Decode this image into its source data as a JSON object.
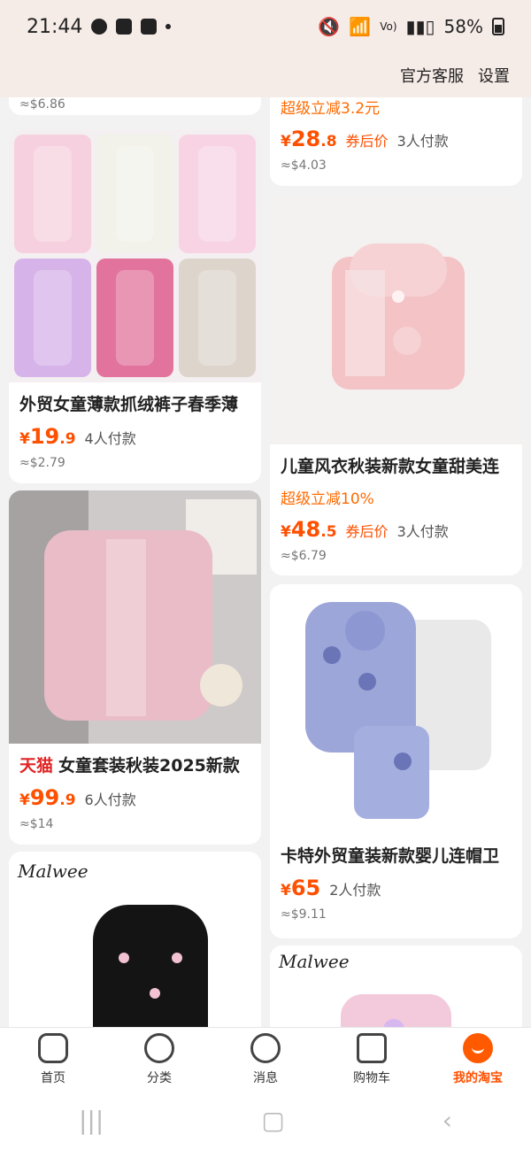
{
  "status_bar": {
    "time": "21:44",
    "battery": "58%"
  },
  "top_bar": {
    "service_link": "官方客服",
    "settings_link": "设置"
  },
  "products": [
    {
      "id": "p0",
      "partial_top_usd": "≈$6.86"
    },
    {
      "id": "p1",
      "promo": "超级立减3.2元",
      "price_int": "28",
      "price_dec": ".8",
      "coupon": "券后价",
      "paid_count": "3人付款",
      "usd": "≈$4.03"
    },
    {
      "id": "p2",
      "title": "外贸女童薄款抓绒裤子春季薄",
      "price_int": "19",
      "price_dec": ".9",
      "paid_count": "4人付款",
      "usd": "≈$2.79"
    },
    {
      "id": "p3",
      "title": "儿童风衣秋装新款女童甜美连",
      "promo": "超级立减10%",
      "price_int": "48",
      "price_dec": ".5",
      "coupon": "券后价",
      "paid_count": "3人付款",
      "usd": "≈$6.79"
    },
    {
      "id": "p4",
      "tmall_tag": "天猫",
      "title": "女童套装秋装2025新款",
      "price_int": "99",
      "price_dec": ".9",
      "paid_count": "6人付款",
      "usd": "≈$14"
    },
    {
      "id": "p5",
      "title": "卡特外贸童装新款婴儿连帽卫",
      "price_int": "65",
      "price_dec": "",
      "paid_count": "2人付款",
      "usd": "≈$9.11"
    },
    {
      "id": "p6",
      "brand": "Malwee"
    },
    {
      "id": "p7",
      "brand": "Malwee"
    }
  ],
  "bottom_nav": [
    {
      "label": "首页",
      "icon": "home-icon"
    },
    {
      "label": "分类",
      "icon": "category-search-icon"
    },
    {
      "label": "消息",
      "icon": "message-icon"
    },
    {
      "label": "购物车",
      "icon": "cart-icon"
    },
    {
      "label": "我的淘宝",
      "icon": "my-taobao-icon"
    }
  ],
  "currency_symbol": "¥",
  "accent_color": "#ff5000",
  "tmall_color": "#e02525"
}
